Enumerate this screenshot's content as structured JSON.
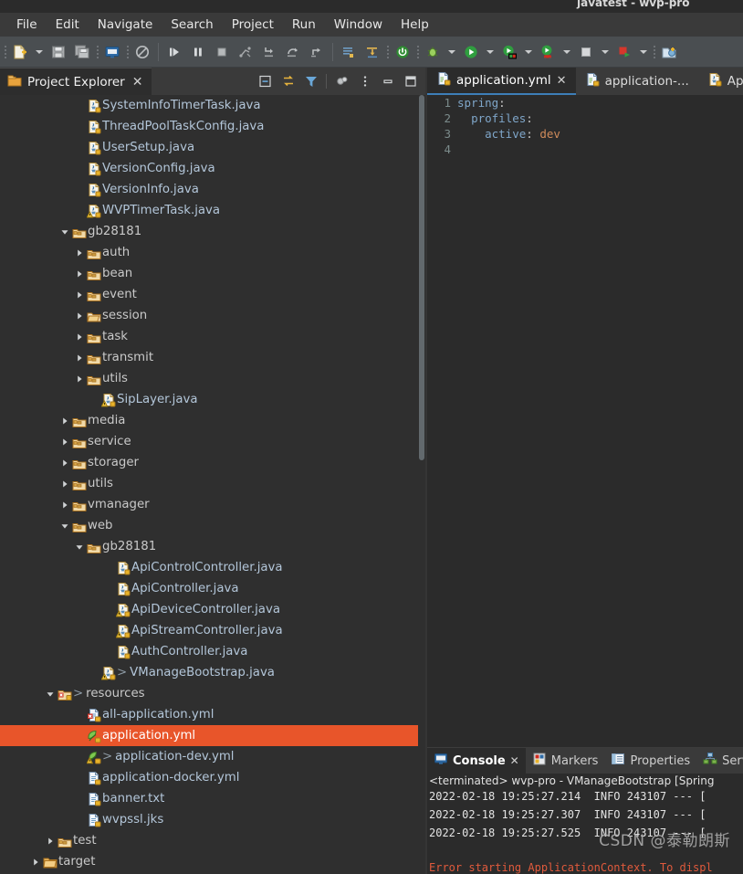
{
  "window": {
    "title": "javatest - wvp-pro"
  },
  "menubar": {
    "items": [
      {
        "label": "File"
      },
      {
        "label": "Edit"
      },
      {
        "label": "Navigate"
      },
      {
        "label": "Search"
      },
      {
        "label": "Project"
      },
      {
        "label": "Run"
      },
      {
        "label": "Window"
      },
      {
        "label": "Help"
      }
    ]
  },
  "toolbar": {
    "icons": [
      "new-file-icon",
      "new-file-dropdown-icon",
      "save-icon",
      "save-all-icon",
      "console-icon",
      "no-entry-icon",
      "resume-icon",
      "suspend-icon",
      "terminate-icon",
      "disconnect-icon",
      "step-into-icon",
      "step-over-icon",
      "step-return-icon",
      "open-type-icon",
      "next-annotation-icon",
      "power-icon",
      "debug-icon",
      "run-icon",
      "coverage-icon",
      "profile-icon",
      "stop-icon",
      "run-last-icon",
      "new-package-icon"
    ]
  },
  "project_explorer": {
    "tab_label": "Project Explorer",
    "tools": [
      "collapse-all-icon",
      "link-with-editor-icon",
      "filter-icon",
      "view-menu-icon",
      "view-options-icon",
      "minimize-icon",
      "maximize-icon"
    ],
    "tree": [
      {
        "label": "SystemInfoTimerTask.java",
        "indent": 5,
        "arrow": "none",
        "icon": "java-file-icon",
        "kind": "file"
      },
      {
        "label": "ThreadPoolTaskConfig.java",
        "indent": 5,
        "arrow": "none",
        "icon": "java-file-icon",
        "kind": "file"
      },
      {
        "label": "UserSetup.java",
        "indent": 5,
        "arrow": "none",
        "icon": "java-file-icon",
        "kind": "file"
      },
      {
        "label": "VersionConfig.java",
        "indent": 5,
        "arrow": "none",
        "icon": "java-file-icon",
        "kind": "file"
      },
      {
        "label": "VersionInfo.java",
        "indent": 5,
        "arrow": "none",
        "icon": "java-file-icon",
        "kind": "file"
      },
      {
        "label": "WVPTimerTask.java",
        "indent": 5,
        "arrow": "none",
        "icon": "java-file-warn-icon",
        "kind": "file"
      },
      {
        "label": "gb28181",
        "indent": 4,
        "arrow": "down",
        "icon": "package-icon",
        "kind": "package"
      },
      {
        "label": "auth",
        "indent": 5,
        "arrow": "right",
        "icon": "package-icon",
        "kind": "package"
      },
      {
        "label": "bean",
        "indent": 5,
        "arrow": "right",
        "icon": "package-icon",
        "kind": "package"
      },
      {
        "label": "event",
        "indent": 5,
        "arrow": "right",
        "icon": "package-icon",
        "kind": "package"
      },
      {
        "label": "session",
        "indent": 5,
        "arrow": "right",
        "icon": "package-open-icon",
        "kind": "package"
      },
      {
        "label": "task",
        "indent": 5,
        "arrow": "right",
        "icon": "package-icon",
        "kind": "package"
      },
      {
        "label": "transmit",
        "indent": 5,
        "arrow": "right",
        "icon": "package-icon",
        "kind": "package"
      },
      {
        "label": "utils",
        "indent": 5,
        "arrow": "right",
        "icon": "package-icon",
        "kind": "package"
      },
      {
        "label": "SipLayer.java",
        "indent": 6,
        "arrow": "none",
        "icon": "java-file-warn-icon",
        "kind": "file"
      },
      {
        "label": "media",
        "indent": 4,
        "arrow": "right",
        "icon": "package-icon",
        "kind": "package"
      },
      {
        "label": "service",
        "indent": 4,
        "arrow": "right",
        "icon": "package-icon",
        "kind": "package"
      },
      {
        "label": "storager",
        "indent": 4,
        "arrow": "right",
        "icon": "package-icon",
        "kind": "package"
      },
      {
        "label": "utils",
        "indent": 4,
        "arrow": "right",
        "icon": "package-icon",
        "kind": "package"
      },
      {
        "label": "vmanager",
        "indent": 4,
        "arrow": "right",
        "icon": "package-icon",
        "kind": "package"
      },
      {
        "label": "web",
        "indent": 4,
        "arrow": "down",
        "icon": "package-icon",
        "kind": "package"
      },
      {
        "label": "gb28181",
        "indent": 5,
        "arrow": "down",
        "icon": "package-icon",
        "kind": "package"
      },
      {
        "label": "ApiControlController.java",
        "indent": 7,
        "arrow": "none",
        "icon": "java-file-icon",
        "kind": "file"
      },
      {
        "label": "ApiController.java",
        "indent": 7,
        "arrow": "none",
        "icon": "java-file-icon",
        "kind": "file"
      },
      {
        "label": "ApiDeviceController.java",
        "indent": 7,
        "arrow": "none",
        "icon": "java-file-warn-icon",
        "kind": "file"
      },
      {
        "label": "ApiStreamController.java",
        "indent": 7,
        "arrow": "none",
        "icon": "java-file-warn-icon",
        "kind": "file"
      },
      {
        "label": "AuthController.java",
        "indent": 7,
        "arrow": "none",
        "icon": "java-file-icon",
        "kind": "file"
      },
      {
        "label": "VManageBootstrap.java",
        "indent": 6,
        "arrow": "none",
        "icon": "java-file-warn-icon",
        "kind": "file",
        "marker": ">"
      },
      {
        "label": "resources",
        "indent": 3,
        "arrow": "down",
        "icon": "source-folder-err-icon",
        "kind": "package",
        "marker": ">"
      },
      {
        "label": "all-application.yml",
        "indent": 5,
        "arrow": "none",
        "icon": "yml-err-icon",
        "kind": "file"
      },
      {
        "label": "application.yml",
        "indent": 5,
        "arrow": "none",
        "icon": "yml-leaf-icon",
        "kind": "file",
        "selected": true
      },
      {
        "label": "application-dev.yml",
        "indent": 5,
        "arrow": "none",
        "icon": "yml-leaf-warn-icon",
        "kind": "file",
        "marker": ">"
      },
      {
        "label": "application-docker.yml",
        "indent": 5,
        "arrow": "none",
        "icon": "text-file-icon",
        "kind": "file"
      },
      {
        "label": "banner.txt",
        "indent": 5,
        "arrow": "none",
        "icon": "text-file-icon",
        "kind": "file"
      },
      {
        "label": "wvpssl.jks",
        "indent": 5,
        "arrow": "none",
        "icon": "text-file-icon",
        "kind": "file"
      },
      {
        "label": "test",
        "indent": 3,
        "arrow": "right",
        "icon": "package-icon",
        "kind": "package"
      },
      {
        "label": "target",
        "indent": 2,
        "arrow": "right",
        "icon": "folder-icon",
        "kind": "folder",
        "dim": true
      }
    ]
  },
  "editor": {
    "tabs": [
      {
        "label": "application.yml",
        "icon": "yml-file-icon",
        "active": true,
        "closable": true
      },
      {
        "label": "application-...",
        "icon": "yml-file-icon",
        "active": false,
        "closable": false
      },
      {
        "label": "ApiC",
        "icon": "java-file-icon",
        "active": false,
        "closable": false
      }
    ],
    "lines": [
      {
        "num": "1",
        "indent": 0,
        "key": "spring",
        "value": ""
      },
      {
        "num": "2",
        "indent": 2,
        "key": "profiles",
        "value": ""
      },
      {
        "num": "3",
        "indent": 4,
        "key": "active",
        "value": "dev"
      },
      {
        "num": "4",
        "indent": 0,
        "key": "",
        "value": ""
      }
    ]
  },
  "console": {
    "tabs": [
      {
        "label": "Console",
        "icon": "console-icon",
        "active": true,
        "closable": true
      },
      {
        "label": "Markers",
        "icon": "markers-icon",
        "active": false,
        "closable": false
      },
      {
        "label": "Properties",
        "icon": "properties-icon",
        "active": false,
        "closable": false
      },
      {
        "label": "Serve",
        "icon": "servers-icon",
        "active": false,
        "closable": false
      }
    ],
    "header": "<terminated> wvp-pro - VManageBootstrap [Spring",
    "lines": [
      "2022-02-18 19:25:27.214  INFO 243107 --- [",
      "2022-02-18 19:25:27.307  INFO 243107 --- [",
      "2022-02-18 19:25:27.525  INFO 243107 --- ["
    ],
    "error_line": "Error starting ApplicationContext. To displ",
    "watermark": "CSDN @泰勒朗斯"
  },
  "colors": {
    "selection": "#e8552a",
    "accent": "#3d7eb8",
    "editor_bg": "#2b2b2b",
    "panel_bg": "#2f2f2f",
    "toolbar_bg": "#4a4e51",
    "error": "#e05a3c"
  }
}
